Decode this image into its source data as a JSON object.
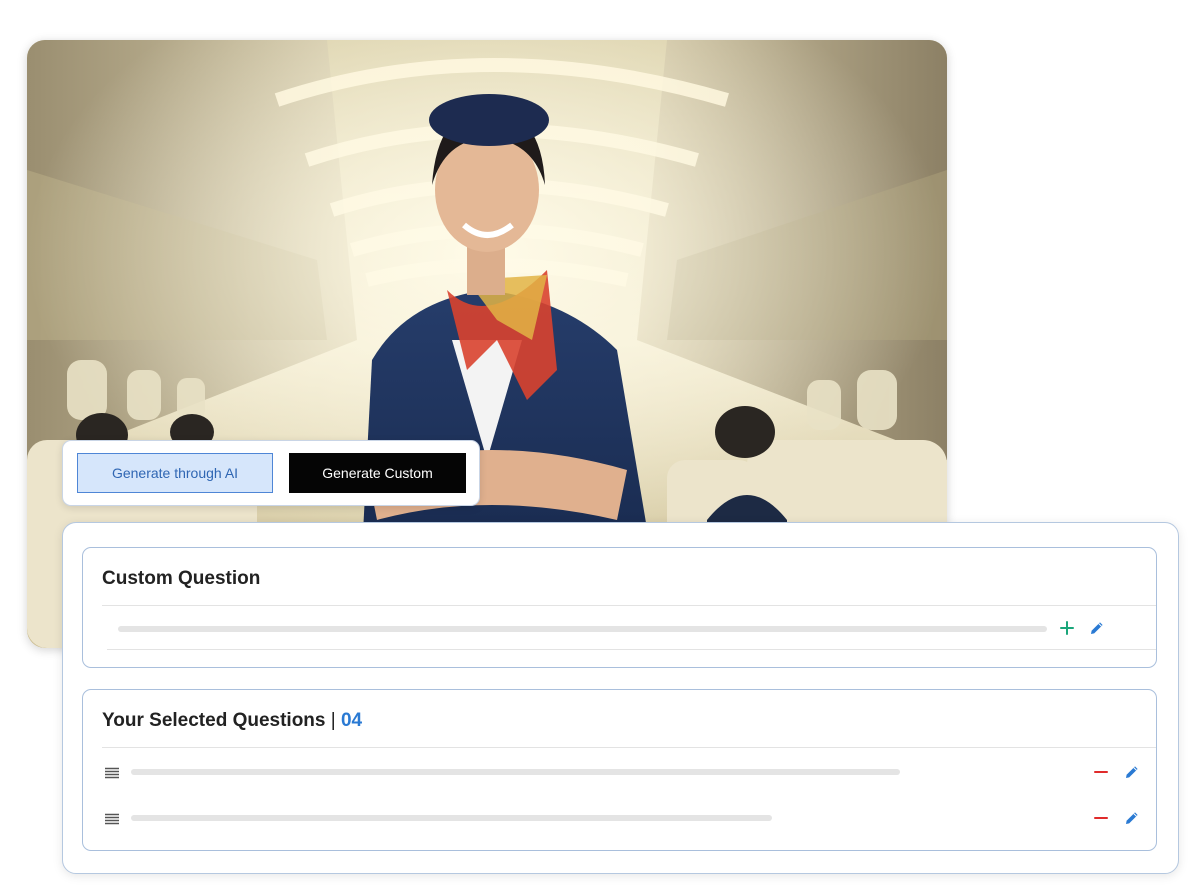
{
  "generate": {
    "ai_label": "Generate through AI",
    "custom_label": "Generate Custom"
  },
  "custom_section": {
    "title": "Custom Question"
  },
  "selected_section": {
    "title": "Your Selected Questions",
    "separator": "|",
    "count": "04"
  },
  "icons": {
    "add": "plus-icon",
    "edit": "pencil-icon",
    "remove": "minus-icon",
    "drag": "drag-handle-icon"
  },
  "colors": {
    "accent_blue": "#2a7ad3",
    "add_green": "#1aa67a",
    "remove_red": "#e02b2b",
    "ai_button_bg": "#d6e6fb",
    "custom_button_bg": "#050505"
  }
}
